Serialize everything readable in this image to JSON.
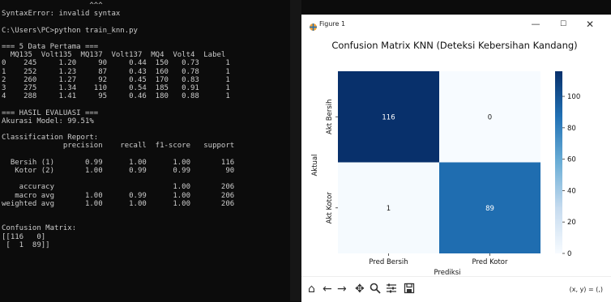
{
  "terminal": {
    "lines": [
      "                    ^^^",
      "SyntaxError: invalid syntax",
      "",
      "C:\\Users\\PC>python train_knn.py",
      "",
      "=== 5 Data Pertama ===",
      "  MQ135  Volt135  MQ137  Volt137  MQ4  Volt4  Label",
      "0    245     1.20     90     0.44  150   0.73      1",
      "1    252     1.23     87     0.43  160   0.78      1",
      "2    260     1.27     92     0.45  170   0.83      1",
      "3    275     1.34    110     0.54  185   0.91      1",
      "4    288     1.41     95     0.46  180   0.88      1",
      "",
      "=== HASIL EVALUASI ===",
      "Akurasi Model: 99.51%",
      "",
      "Classification Report:",
      "              precision    recall  f1-score   support",
      "",
      "  Bersih (1)       0.99      1.00      1.00       116",
      "   Kotor (2)       1.00      0.99      0.99        90",
      "",
      "    accuracy                           1.00       206",
      "   macro avg       1.00      0.99      1.00       206",
      "weighted avg       1.00      1.00      1.00       206",
      "",
      "",
      "Confusion Matrix:",
      "[[116   0]",
      " [  1  89]]"
    ]
  },
  "figure_window": {
    "title": "Figure 1",
    "minimize": "—",
    "maximize": "☐",
    "close": "✕",
    "icon": "figure-app-icon"
  },
  "chart_data": {
    "type": "heatmap",
    "title": "Confusion Matrix KNN (Deteksi Kebersihan Kandang)",
    "xlabel": "Prediksi",
    "ylabel": "Aktual",
    "x_categories": [
      "Pred Bersih",
      "Pred Kotor"
    ],
    "y_categories": [
      "Akt Bersih",
      "Akt Kotor"
    ],
    "values": [
      [
        116,
        0
      ],
      [
        1,
        89
      ]
    ],
    "colormap": "Blues",
    "colorbar": {
      "min": 0,
      "max": 116,
      "ticks": [
        0,
        20,
        40,
        60,
        80,
        100
      ]
    },
    "colors": {
      "low": "#f7fbff",
      "high": "#08306b",
      "annot_dark": "#ffffff",
      "annot_light": "#1a1a1a"
    }
  },
  "toolbar": {
    "home": "home-icon",
    "back": "back-arrow-icon",
    "forward": "forward-arrow-icon",
    "pan": "pan-icon",
    "zoom": "zoom-icon",
    "configure": "configure-subplots-icon",
    "save": "save-icon",
    "coords": "(x, y) = (,)"
  }
}
